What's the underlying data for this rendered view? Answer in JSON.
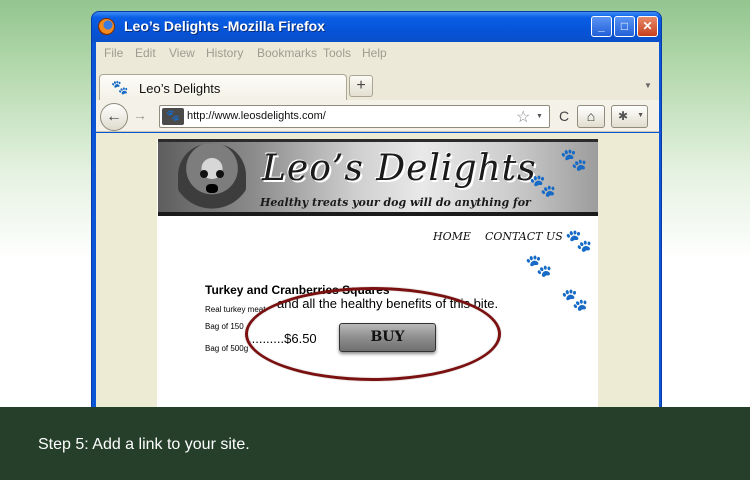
{
  "window": {
    "title": "Leo’s Delights -Mozilla Firefox",
    "controls": {
      "minimize": "_",
      "maximize": "□",
      "close": "✕"
    }
  },
  "menubar": {
    "items": [
      "File",
      "Edit",
      "View",
      "History",
      "Bookmarks",
      "Tools",
      "Help"
    ]
  },
  "tabs": [
    {
      "label": "Leo’s Delights",
      "icon": "paw-icon"
    }
  ],
  "tabstrip": {
    "new_tab": "+",
    "tab_list": "▼"
  },
  "navbar": {
    "back": "←",
    "forward": "→",
    "url": "http://www.leosdelights.com/",
    "star": "☆",
    "url_dropdown": "▼",
    "reload": "C",
    "home": "⌂",
    "addon_dropdown": "▼"
  },
  "site": {
    "title": "Leo’s Delights",
    "tagline": "Healthy treats your dog will do anything for",
    "nav": {
      "home": "HOME",
      "contact": "CONTACT US"
    },
    "product": {
      "title": "Turkey and Cranberries Squares",
      "desc_small": "Real turkey meat",
      "desc_big": "and all the healthy benefits of this bite.",
      "bag_1": "Bag of 150",
      "bag_2": "Bag of 500g",
      "price": "..........$6.50",
      "buy_label": "BUY"
    },
    "paw_glyph": "🐾",
    "accent_oval_color": "#7b1010"
  },
  "caption": "Step 5: Add a link to your site."
}
